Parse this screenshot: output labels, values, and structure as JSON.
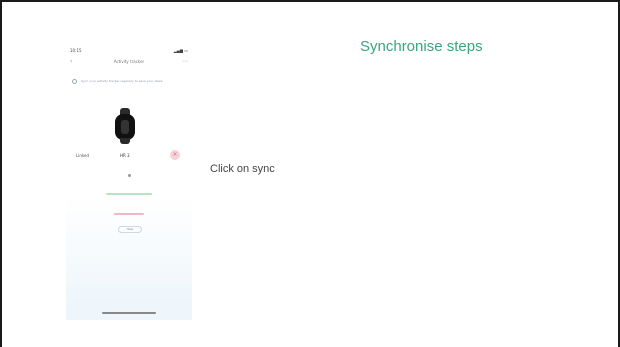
{
  "slide": {
    "title": "Synchronise steps",
    "caption": "Click on sync",
    "title_color": "#3aa57c"
  },
  "phone": {
    "status_time": "10:15",
    "status_icons": "▂▄▆ ▭",
    "nav_title": "Activity tracker",
    "back_icon": "chevron-left-icon",
    "more_icon": "more-icon",
    "notice_text": "Sync your activity tracker regularly to save your steps",
    "device_label": "Linked",
    "device_name": "HR 3",
    "delete_icon": "close-icon",
    "button_label": "Help"
  }
}
